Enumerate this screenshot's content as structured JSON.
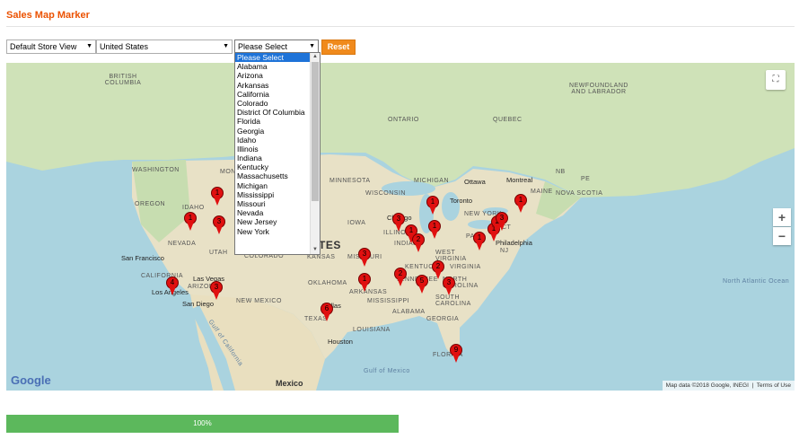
{
  "page": {
    "title": "Sales Map Marker"
  },
  "filters": {
    "store_view": "Default Store View",
    "country": "United States",
    "state": "Please Select",
    "reset_label": "Reset"
  },
  "state_options": [
    "Please Select",
    "Alabama",
    "Arizona",
    "Arkansas",
    "California",
    "Colorado",
    "District Of Columbia",
    "Florida",
    "Georgia",
    "Idaho",
    "Illinois",
    "Indiana",
    "Kentucky",
    "Massachusetts",
    "Michigan",
    "Mississippi",
    "Missouri",
    "Nevada",
    "New Jersey",
    "New York"
  ],
  "map": {
    "water_labels": [
      "North Atlantic Ocean",
      "Gulf of Mexico",
      "Gulf of California"
    ],
    "region_labels": [
      "BRITISH COLUMBIA",
      "NEWFOUNDLAND AND LABRADOR",
      "ONTARIO",
      "QUEBEC",
      "WASHINGTON",
      "MONTANA",
      "MINNESOTA",
      "OREGON",
      "IDAHO",
      "WISCONSIN",
      "MICHIGAN",
      "IOWA",
      "ILLINOIS",
      "INDIANA",
      "NEVADA",
      "UTAH",
      "COLORADO",
      "KANSAS",
      "MISSOURI",
      "KENTUCKY",
      "VIRGINIA",
      "WEST VIRGINIA",
      "CALIFORNIA",
      "ARIZONA",
      "NEW MEXICO",
      "OKLAHOMA",
      "ARKANSAS",
      "TENNESSEE",
      "NORTH CAROLINA",
      "SOUTH CAROLINA",
      "MISSISSIPPI",
      "ALABAMA",
      "GEORGIA",
      "TEXAS",
      "LOUISIANA",
      "FLORIDA",
      "MAINE",
      "NOVA SCOTIA",
      "NB",
      "PE",
      "NEW YORK",
      "PA",
      "NJ",
      "CT"
    ],
    "country_label": "Mexico",
    "states_label": "tes",
    "city_labels": [
      "Ottawa",
      "Montreal",
      "Toronto",
      "Chicago",
      "Philadelphia",
      "San Francisco",
      "Las Vegas",
      "Los Angeles",
      "San Diego",
      "Dallas",
      "Houston"
    ],
    "markers": [
      "1",
      "1",
      "3",
      "4",
      "3",
      "3",
      "1",
      "2",
      "1",
      "1",
      "1",
      "1",
      "2",
      "3",
      "1",
      "2",
      "3",
      "5",
      "3",
      "1",
      "2",
      "6",
      "9"
    ],
    "attribution": "Map data ©2018 Google, INEGI",
    "terms": "Terms of Use",
    "logo": "Google",
    "icons": [
      "fullscreen-icon",
      "zoom-in-icon",
      "zoom-out-icon"
    ]
  },
  "progress": {
    "label": "100%",
    "value": 100
  }
}
